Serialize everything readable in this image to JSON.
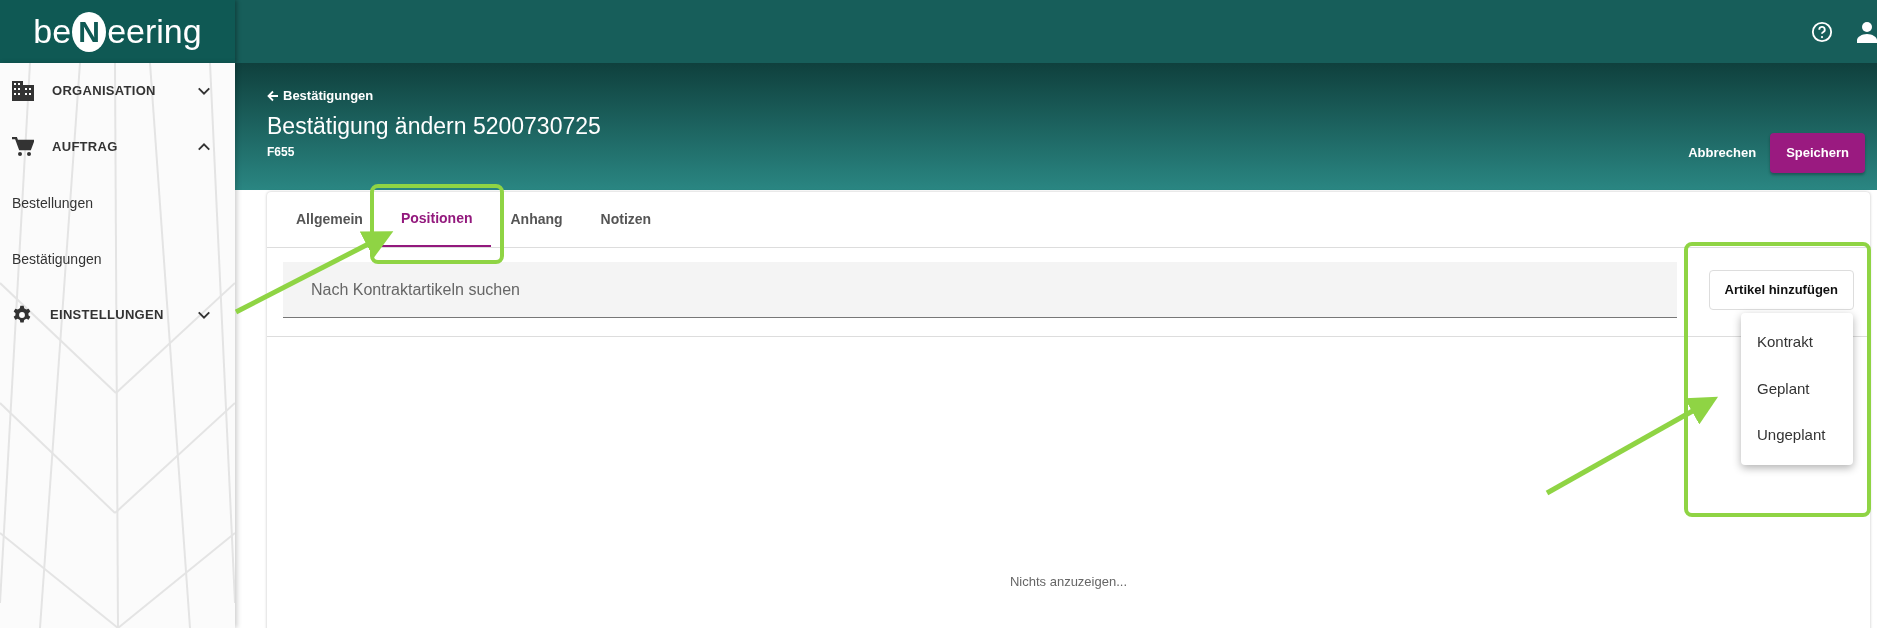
{
  "logo": {
    "before": "be",
    "mark": "N",
    "after": "eering"
  },
  "sidebar": {
    "items": [
      {
        "kind": "group",
        "label": "ORGANISATION",
        "expanded": false
      },
      {
        "kind": "group",
        "label": "AUFTRAG",
        "expanded": true
      },
      {
        "kind": "link",
        "label": "Bestellungen"
      },
      {
        "kind": "link",
        "label": "Bestätigungen"
      },
      {
        "kind": "group",
        "label": "EINSTELLUNGEN",
        "expanded": false
      }
    ]
  },
  "header": {
    "back_link": "Bestätigungen",
    "title": "Bestätigung ändern 5200730725",
    "subtitle": "F655",
    "buttons": [
      {
        "kind": "text",
        "label": "Abbrechen"
      },
      {
        "kind": "primary",
        "label": "Speichern"
      }
    ]
  },
  "tabs": [
    {
      "label": "Allgemein",
      "selected": false
    },
    {
      "label": "Positionen",
      "selected": true
    },
    {
      "label": "Anhang",
      "selected": false
    },
    {
      "label": "Notizen",
      "selected": false
    }
  ],
  "search": {
    "placeholder": "Nach Kontraktartikeln suchen"
  },
  "add_button": {
    "label": "Artikel hinzufügen"
  },
  "add_menu": {
    "items": [
      "Kontrakt",
      "Geplant",
      "Ungeplant"
    ]
  },
  "empty_text": "Nichts anzuzeigen..."
}
